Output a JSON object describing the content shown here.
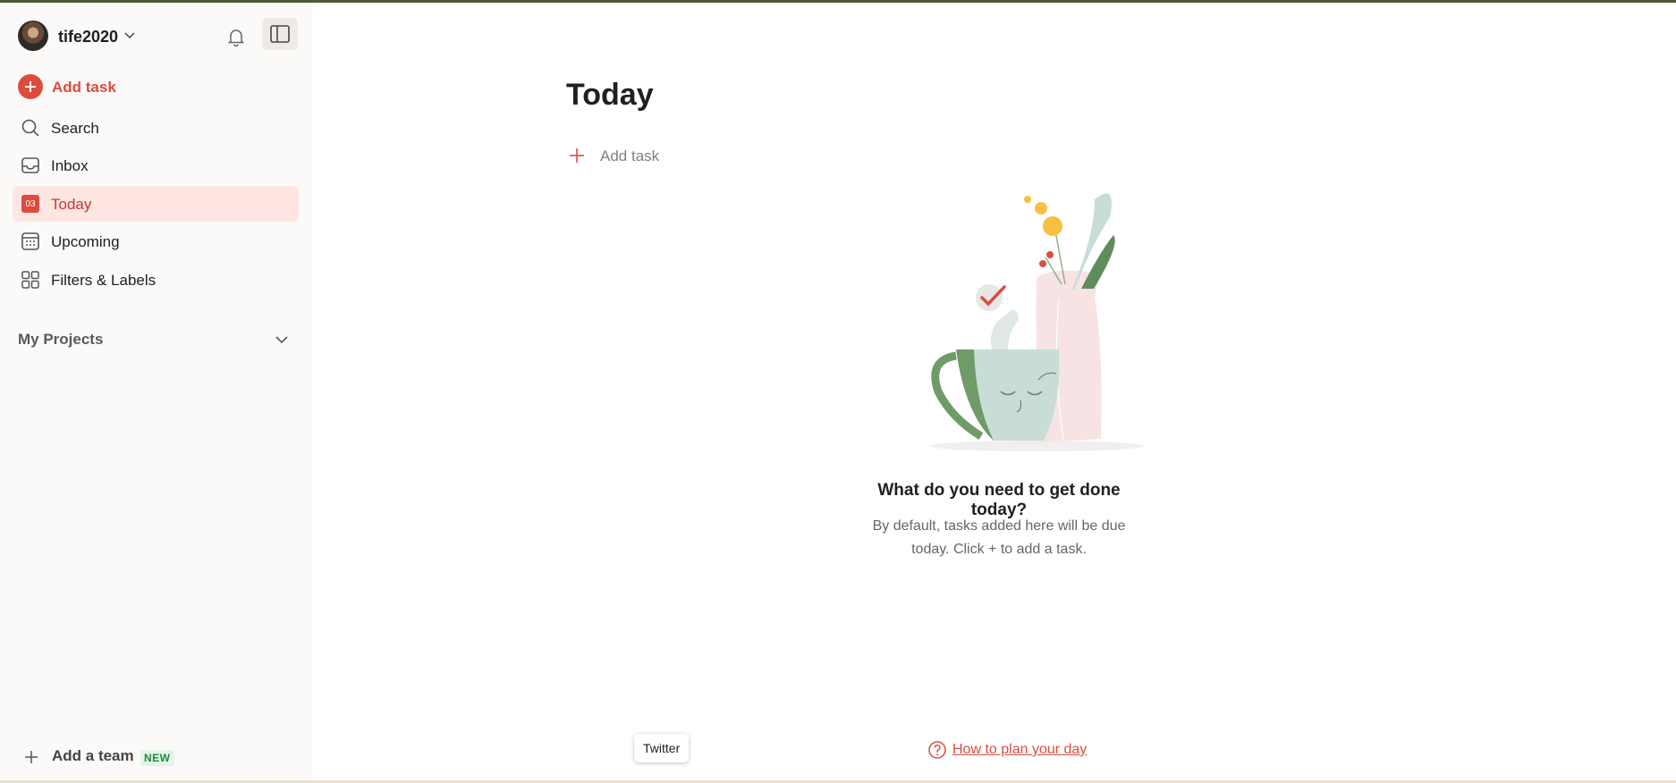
{
  "user": {
    "name": "tife2020"
  },
  "sidebar": {
    "add_task": "Add task",
    "items": [
      {
        "label": "Search",
        "icon": "search-icon"
      },
      {
        "label": "Inbox",
        "icon": "inbox-icon"
      },
      {
        "label": "Today",
        "icon": "calendar-today-icon",
        "day": "03",
        "active": true
      },
      {
        "label": "Upcoming",
        "icon": "calendar-grid-icon"
      },
      {
        "label": "Filters & Labels",
        "icon": "filters-grid-icon"
      }
    ],
    "projects_label": "My Projects",
    "add_team": "Add a team",
    "new_badge": "NEW"
  },
  "main": {
    "title": "Today",
    "add_task": "Add task",
    "empty_title": "What do you need to get done today?",
    "empty_desc": "By default, tasks added here will be due today. Click + to add a task.",
    "help_link": "How to plan your day"
  },
  "tooltip": "Twitter",
  "colors": {
    "accent": "#dc4c3e",
    "active_bg": "#ffe6e3",
    "sidebar_bg": "#fcfaf8"
  }
}
